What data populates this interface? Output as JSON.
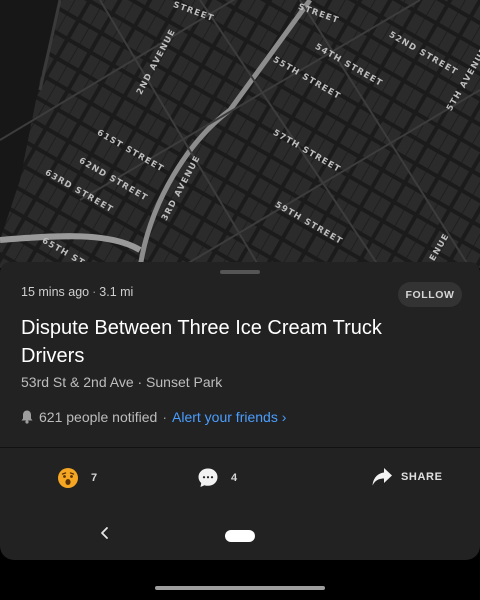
{
  "map": {
    "streets": [
      "STREET",
      "STREET",
      "2ND AVENUE",
      "54TH STREET",
      "52ND STREET",
      "55TH STREET",
      "5TH AVENUE",
      "57TH STREET",
      "61ST STREET",
      "62ND STREET",
      "63RD STREET",
      "3RD AVENUE",
      "59TH STREET",
      "65TH ST",
      "ENUE"
    ]
  },
  "incident": {
    "time_ago": "15 mins ago",
    "distance": "3.1 mi",
    "follow_label": "FOLLOW",
    "title": "Dispute Between Three Ice Cream Truck Drivers",
    "location": "53rd St & 2nd Ave · Sunset Park",
    "notified": "621 people notified",
    "alert_label": "Alert your friends ›"
  },
  "actions": {
    "reaction_count": "7",
    "comment_count": "4",
    "share_label": "SHARE"
  },
  "icons": {
    "reaction": "shocked-face-icon",
    "comment": "chat-bubble-icon",
    "share": "share-arrow-icon",
    "bell": "bell-icon",
    "back": "back-chevron-icon"
  },
  "colors": {
    "link": "#4a9eff",
    "sheet": "#222222",
    "emoji": "#f5a623"
  }
}
